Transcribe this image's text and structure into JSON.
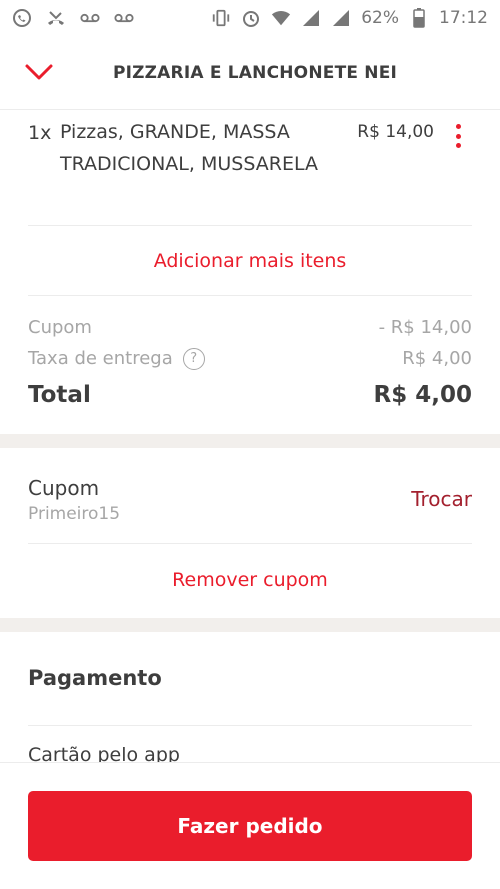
{
  "status_bar": {
    "battery": "62%",
    "time": "17:12"
  },
  "header": {
    "title": "PIZZARIA E LANCHONETE NEI",
    "back_icon": "chevron-down-icon"
  },
  "order_item": {
    "quantity": "1x",
    "description": "Pizzas, GRANDE, MASSA TRADICIONAL, MUSSARELA",
    "price": "R$ 14,00"
  },
  "add_more_label": "Adicionar mais itens",
  "summary": {
    "coupon_label": "Cupom",
    "coupon_value": "- R$ 14,00",
    "delivery_label": "Taxa de entrega",
    "delivery_value": "R$ 4,00",
    "help_symbol": "?",
    "total_label": "Total",
    "total_value": "R$ 4,00"
  },
  "coupon_section": {
    "title": "Cupom",
    "code": "Primeiro15",
    "change_label": "Trocar",
    "remove_label": "Remover cupom"
  },
  "payment": {
    "title": "Pagamento",
    "method": "Cartão pelo app"
  },
  "cta": {
    "label": "Fazer pedido"
  },
  "colors": {
    "primary": "#ea1d2c",
    "dark_red": "#a3202e",
    "text": "#3e3e3e",
    "muted": "#a6a6a6",
    "divider": "#f2efec"
  }
}
